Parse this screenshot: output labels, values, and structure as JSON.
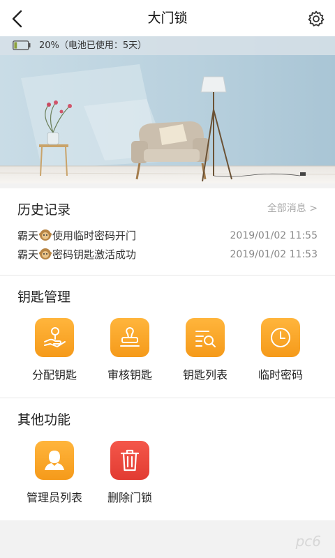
{
  "header": {
    "title": "大门锁",
    "back_icon": "chevron-left-icon",
    "settings_icon": "gear-icon"
  },
  "battery": {
    "text": "20%（电池已使用：5天）",
    "level": 0.2,
    "color": "#8ca03c"
  },
  "history": {
    "title": "历史记录",
    "more_label": "全部消息 >",
    "items": [
      {
        "user": "霸天",
        "action": "使用临时密码开门",
        "time": "2019/01/02 11:55"
      },
      {
        "user": "霸天",
        "action": "密码钥匙激活成功",
        "time": "2019/01/02 11:53"
      }
    ]
  },
  "key_management": {
    "title": "钥匙管理",
    "items": [
      {
        "label": "分配钥匙",
        "icon": "hand-key-icon"
      },
      {
        "label": "审核钥匙",
        "icon": "stamp-icon"
      },
      {
        "label": "钥匙列表",
        "icon": "list-search-icon"
      },
      {
        "label": "临时密码",
        "icon": "clock-icon"
      }
    ]
  },
  "other_functions": {
    "title": "其他功能",
    "items": [
      {
        "label": "管理员列表",
        "icon": "admin-user-icon"
      },
      {
        "label": "删除门锁",
        "icon": "trash-icon"
      }
    ]
  },
  "colors": {
    "accent_orange": "#f7a42a",
    "danger_red": "#ea473d",
    "text_gray": "#888888"
  }
}
